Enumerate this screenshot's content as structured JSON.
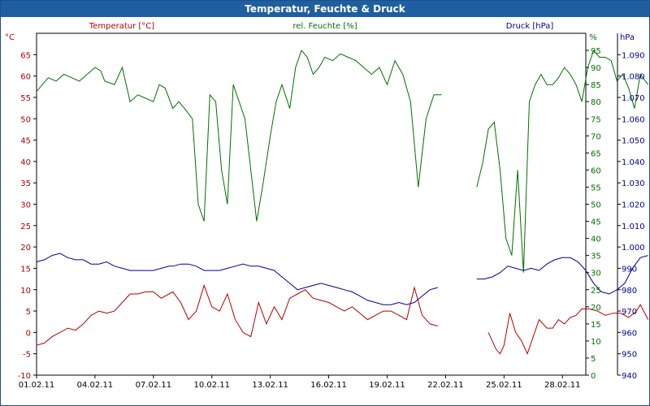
{
  "window": {
    "title": "Temperatur, Feuchte & Druck"
  },
  "colors": {
    "temperature": "#b00000",
    "humidity": "#007000",
    "pressure": "#000090",
    "grid": "#000000",
    "title_bg": "#1f5f9f"
  },
  "chart_data": {
    "type": "line",
    "title": "Temperatur, Feuchte & Druck",
    "grid": true,
    "x_ticks": [
      "01.02.11",
      "04.02.11",
      "07.02.11",
      "10.02.11",
      "13.02.11",
      "16.02.11",
      "19.02.11",
      "22.02.11",
      "25.02.11",
      "28.02.11"
    ],
    "xlim": [
      0,
      28.2
    ],
    "axes": {
      "temperature": {
        "unit": "°C",
        "ylim": [
          -10,
          70
        ],
        "ticks": [
          -10,
          -5,
          0,
          5,
          10,
          15,
          20,
          25,
          30,
          35,
          40,
          45,
          50,
          55,
          60,
          65
        ]
      },
      "humidity": {
        "unit": "%",
        "ylim": [
          0,
          100
        ],
        "ticks": [
          0,
          5,
          10,
          15,
          20,
          25,
          30,
          35,
          40,
          45,
          50,
          55,
          60,
          65,
          70,
          75,
          80,
          85,
          90,
          95
        ]
      },
      "pressure": {
        "unit": "hPa",
        "ylim": [
          940,
          1100
        ],
        "ticks": [
          "940",
          "950",
          "960",
          "970",
          "980",
          "990",
          "1.000",
          "1.010",
          "1.020",
          "1.030",
          "1.040",
          "1.050",
          "1.060",
          "1.070",
          "1.080",
          "1.090"
        ]
      }
    },
    "series": [
      {
        "name": "Temperatur [°C]",
        "axis": "temperature",
        "segments": [
          [
            [
              0,
              -3
            ],
            [
              0.4,
              -2.5
            ],
            [
              0.8,
              -1
            ],
            [
              1.2,
              0
            ],
            [
              1.6,
              1
            ],
            [
              2,
              0.5
            ],
            [
              2.4,
              2
            ],
            [
              2.8,
              4
            ],
            [
              3.2,
              5
            ],
            [
              3.6,
              4.5
            ],
            [
              4,
              5
            ],
            [
              4.4,
              7
            ],
            [
              4.8,
              9
            ],
            [
              5.2,
              9
            ],
            [
              5.6,
              9.5
            ],
            [
              6,
              9.5
            ],
            [
              6.4,
              8
            ],
            [
              6.8,
              9
            ],
            [
              7,
              9.5
            ],
            [
              7.4,
              7
            ],
            [
              7.8,
              3
            ],
            [
              8.2,
              5
            ],
            [
              8.6,
              11
            ],
            [
              9,
              6
            ],
            [
              9.4,
              5
            ],
            [
              9.8,
              9
            ],
            [
              10.2,
              3
            ],
            [
              10.6,
              0
            ],
            [
              11,
              -1
            ],
            [
              11.4,
              7
            ],
            [
              11.8,
              2
            ],
            [
              12.2,
              6
            ],
            [
              12.6,
              3
            ],
            [
              13,
              8
            ],
            [
              13.4,
              9
            ],
            [
              13.8,
              10
            ],
            [
              14.2,
              8
            ],
            [
              14.6,
              7.5
            ],
            [
              15,
              7
            ],
            [
              15.4,
              6
            ],
            [
              15.8,
              5
            ],
            [
              16.2,
              6
            ],
            [
              16.6,
              4.5
            ],
            [
              17,
              3
            ],
            [
              17.4,
              4
            ],
            [
              17.8,
              5
            ],
            [
              18.2,
              5
            ],
            [
              18.6,
              4
            ],
            [
              19,
              3
            ],
            [
              19.4,
              10.5
            ],
            [
              19.8,
              4
            ],
            [
              20.2,
              2
            ],
            [
              20.6,
              1.5
            ]
          ],
          [
            [
              23.2,
              0
            ],
            [
              23.4,
              -2
            ],
            [
              23.6,
              -4
            ],
            [
              23.8,
              -5
            ],
            [
              24,
              -3
            ],
            [
              24.3,
              4.5
            ],
            [
              24.6,
              0
            ],
            [
              24.9,
              -2
            ],
            [
              25.2,
              -5
            ],
            [
              25.5,
              -1
            ],
            [
              25.8,
              3
            ],
            [
              26,
              2
            ],
            [
              26.2,
              1
            ],
            [
              26.5,
              1
            ],
            [
              26.8,
              3
            ],
            [
              27.1,
              2
            ],
            [
              27.4,
              3.5
            ],
            [
              27.7,
              4
            ],
            [
              28,
              5.5
            ],
            [
              28.4,
              5.5
            ],
            [
              28.8,
              5
            ],
            [
              29.2,
              4
            ],
            [
              29.6,
              4.5
            ],
            [
              30,
              4.5
            ],
            [
              30.4,
              3.5
            ],
            [
              30.8,
              5
            ],
            [
              31,
              6.5
            ],
            [
              31.4,
              3
            ]
          ]
        ]
      },
      {
        "name": "rel. Feuchte [%]",
        "axis": "humidity",
        "segments": [
          [
            [
              0,
              83
            ],
            [
              0.3,
              85
            ],
            [
              0.6,
              87
            ],
            [
              1,
              86
            ],
            [
              1.4,
              88
            ],
            [
              1.8,
              87
            ],
            [
              2.2,
              86
            ],
            [
              2.6,
              88
            ],
            [
              3,
              90
            ],
            [
              3.3,
              89
            ],
            [
              3.5,
              86
            ],
            [
              4,
              85
            ],
            [
              4.4,
              90
            ],
            [
              4.8,
              80
            ],
            [
              5.2,
              82
            ],
            [
              5.6,
              81
            ],
            [
              6,
              80
            ],
            [
              6.3,
              85
            ],
            [
              6.6,
              84
            ],
            [
              7,
              78
            ],
            [
              7.3,
              80
            ],
            [
              7.6,
              78
            ],
            [
              8,
              75
            ],
            [
              8.3,
              50
            ],
            [
              8.6,
              45
            ],
            [
              8.9,
              82
            ],
            [
              9.2,
              80
            ],
            [
              9.5,
              60
            ],
            [
              9.8,
              50
            ],
            [
              10.1,
              85
            ],
            [
              10.4,
              80
            ],
            [
              10.7,
              75
            ],
            [
              11,
              60
            ],
            [
              11.3,
              45
            ],
            [
              11.6,
              55
            ],
            [
              12,
              70
            ],
            [
              12.3,
              80
            ],
            [
              12.6,
              85
            ],
            [
              13,
              78
            ],
            [
              13.3,
              90
            ],
            [
              13.6,
              95
            ],
            [
              13.9,
              93
            ],
            [
              14.2,
              88
            ],
            [
              14.5,
              90
            ],
            [
              14.8,
              93
            ],
            [
              15.2,
              92
            ],
            [
              15.6,
              94
            ],
            [
              16,
              93
            ],
            [
              16.4,
              92
            ],
            [
              16.8,
              90
            ],
            [
              17.2,
              88
            ],
            [
              17.6,
              90
            ],
            [
              18,
              85
            ],
            [
              18.4,
              92
            ],
            [
              18.8,
              88
            ],
            [
              19.2,
              80
            ],
            [
              19.6,
              55
            ],
            [
              20,
              75
            ],
            [
              20.4,
              82
            ],
            [
              20.8,
              82
            ]
          ],
          [
            [
              22.6,
              55
            ],
            [
              22.9,
              62
            ],
            [
              23.2,
              72
            ],
            [
              23.5,
              74
            ],
            [
              23.8,
              60
            ],
            [
              24.1,
              40
            ],
            [
              24.4,
              35
            ],
            [
              24.7,
              60
            ],
            [
              25,
              30
            ],
            [
              25.3,
              80
            ],
            [
              25.6,
              85
            ],
            [
              25.9,
              88
            ],
            [
              26.2,
              85
            ],
            [
              26.5,
              85
            ],
            [
              26.8,
              87
            ],
            [
              27.1,
              90
            ],
            [
              27.4,
              88
            ],
            [
              27.7,
              85
            ],
            [
              28,
              80
            ],
            [
              28.3,
              90
            ],
            [
              28.6,
              95
            ],
            [
              28.9,
              93
            ],
            [
              29.2,
              93
            ],
            [
              29.5,
              92
            ],
            [
              29.8,
              86
            ],
            [
              30.1,
              88
            ],
            [
              30.4,
              84
            ],
            [
              30.7,
              78
            ],
            [
              31,
              88
            ],
            [
              31.4,
              85
            ]
          ]
        ]
      },
      {
        "name": "Druck [hPa]",
        "axis": "pressure",
        "segments": [
          [
            [
              0,
              993
            ],
            [
              0.4,
              994
            ],
            [
              0.8,
              996
            ],
            [
              1.2,
              997
            ],
            [
              1.6,
              995
            ],
            [
              2,
              994
            ],
            [
              2.4,
              994
            ],
            [
              2.8,
              992
            ],
            [
              3.2,
              992
            ],
            [
              3.6,
              993
            ],
            [
              4,
              991
            ],
            [
              4.4,
              990
            ],
            [
              4.8,
              989
            ],
            [
              5.2,
              989
            ],
            [
              5.6,
              989
            ],
            [
              6,
              989
            ],
            [
              6.4,
              990
            ],
            [
              6.8,
              991
            ],
            [
              7,
              991
            ],
            [
              7.4,
              992
            ],
            [
              7.8,
              992
            ],
            [
              8.2,
              991
            ],
            [
              8.6,
              989
            ],
            [
              9,
              989
            ],
            [
              9.4,
              989
            ],
            [
              9.8,
              990
            ],
            [
              10.2,
              991
            ],
            [
              10.6,
              992
            ],
            [
              11,
              991
            ],
            [
              11.4,
              991
            ],
            [
              11.8,
              990
            ],
            [
              12.2,
              989
            ],
            [
              12.6,
              986
            ],
            [
              13,
              983
            ],
            [
              13.4,
              980
            ],
            [
              13.8,
              981
            ],
            [
              14.2,
              982
            ],
            [
              14.6,
              983
            ],
            [
              15,
              982
            ],
            [
              15.4,
              981
            ],
            [
              15.8,
              980
            ],
            [
              16.2,
              979
            ],
            [
              16.6,
              977
            ],
            [
              17,
              975
            ],
            [
              17.4,
              974
            ],
            [
              17.8,
              973
            ],
            [
              18.2,
              973
            ],
            [
              18.6,
              974
            ],
            [
              19,
              973
            ],
            [
              19.4,
              974
            ],
            [
              19.8,
              977
            ],
            [
              20.2,
              980
            ],
            [
              20.6,
              981
            ]
          ],
          [
            [
              22.6,
              985
            ],
            [
              23,
              985
            ],
            [
              23.4,
              986
            ],
            [
              23.8,
              988
            ],
            [
              24.2,
              991
            ],
            [
              24.6,
              990
            ],
            [
              25,
              989
            ],
            [
              25.4,
              990
            ],
            [
              25.8,
              989
            ],
            [
              26.2,
              992
            ],
            [
              26.6,
              994
            ],
            [
              27,
              995
            ],
            [
              27.4,
              995
            ],
            [
              27.8,
              993
            ],
            [
              28.2,
              989
            ],
            [
              28.6,
              983
            ],
            [
              29,
              979
            ],
            [
              29.4,
              978
            ],
            [
              29.8,
              980
            ],
            [
              30.2,
              983
            ],
            [
              30.6,
              990
            ],
            [
              31,
              995
            ],
            [
              31.4,
              996
            ]
          ]
        ]
      }
    ]
  }
}
